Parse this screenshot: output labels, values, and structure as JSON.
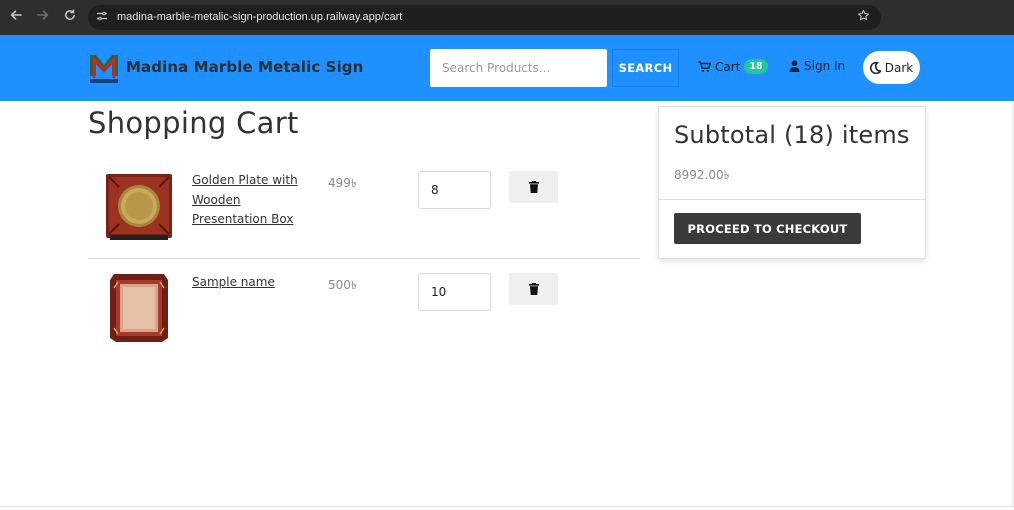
{
  "browser": {
    "url": "madina-marble-metalic-sign-production.up.railway.app/cart",
    "icons": {
      "back": "arrow-left-icon",
      "forward": "arrow-right-icon",
      "reload": "reload-icon",
      "site_info": "site-settings-icon",
      "bookmark": "star-icon"
    }
  },
  "header": {
    "brand": "Madina Marble Metalic Sign",
    "search_placeholder": "Search Products...",
    "search_label": "SEARCH",
    "cart_label": "Cart",
    "cart_count": "18",
    "signin_label": "Sign In",
    "theme_label": "Dark",
    "colors": {
      "bar": "#1e90ff",
      "badge": "#20c997"
    }
  },
  "cart": {
    "title": "Shopping Cart",
    "items": [
      {
        "name": "Golden Plate with Wooden Presentation Box",
        "price": "499৳",
        "qty": "8"
      },
      {
        "name": "Sample name",
        "price": "500৳",
        "qty": "10"
      }
    ]
  },
  "summary": {
    "title": "Subtotal (18) items",
    "amount": "8992.00৳",
    "checkout_label": "PROCEED TO CHECKOUT"
  }
}
